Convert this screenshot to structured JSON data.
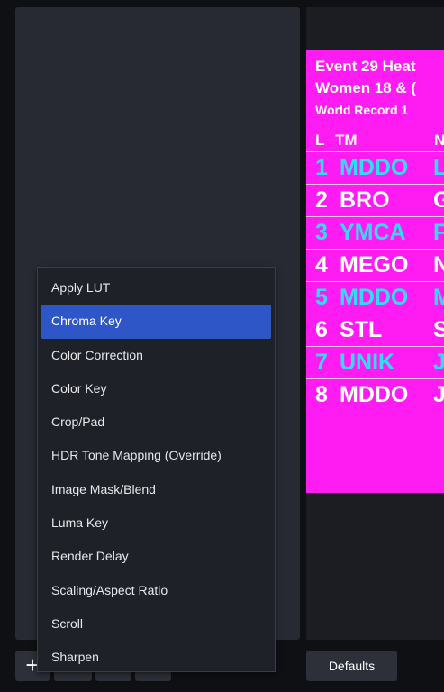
{
  "menu": {
    "items": [
      {
        "label": "Apply LUT",
        "selected": false
      },
      {
        "label": "Chroma Key",
        "selected": true
      },
      {
        "label": "Color Correction",
        "selected": false
      },
      {
        "label": "Color Key",
        "selected": false
      },
      {
        "label": "Crop/Pad",
        "selected": false
      },
      {
        "label": "HDR Tone Mapping (Override)",
        "selected": false
      },
      {
        "label": "Image Mask/Blend",
        "selected": false
      },
      {
        "label": "Luma Key",
        "selected": false
      },
      {
        "label": "Render Delay",
        "selected": false
      },
      {
        "label": "Scaling/Aspect Ratio",
        "selected": false
      },
      {
        "label": "Scroll",
        "selected": false
      },
      {
        "label": "Sharpen",
        "selected": false
      }
    ]
  },
  "toolbar": {
    "add_label": "+",
    "defaults_label": "Defaults"
  },
  "preview": {
    "title_line1": "Event 29 Heat",
    "title_line2": "Women 18 & (",
    "title_line3": "World Record  1",
    "header_lane": "L",
    "header_team": "TM",
    "header_name": "N",
    "rows": [
      {
        "lane": "1",
        "team": "MDDO",
        "initial": "L",
        "color": "cyan"
      },
      {
        "lane": "2",
        "team": "BRO",
        "initial": "G",
        "color": "white"
      },
      {
        "lane": "3",
        "team": "YMCA",
        "initial": "F",
        "color": "cyan"
      },
      {
        "lane": "4",
        "team": "MEGO",
        "initial": "N",
        "color": "white"
      },
      {
        "lane": "5",
        "team": "MDDO",
        "initial": "M",
        "color": "cyan"
      },
      {
        "lane": "6",
        "team": "STL",
        "initial": "S",
        "color": "white"
      },
      {
        "lane": "7",
        "team": "UNIK",
        "initial": "J",
        "color": "cyan"
      },
      {
        "lane": "8",
        "team": "MDDO",
        "initial": "J",
        "color": "white"
      }
    ]
  },
  "colors": {
    "preview_background": "#ff1cf3",
    "selected_item": "#2e56c7",
    "cyan_text": "#31dcf1"
  }
}
